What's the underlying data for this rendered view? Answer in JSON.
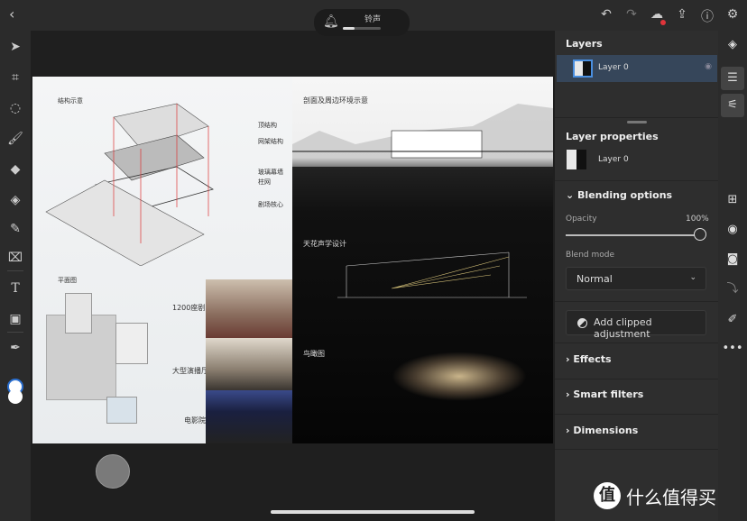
{
  "topbar": {
    "back_icon": "chevron-left-icon",
    "ringer_label": "铃声",
    "ringer_level_percent": 30,
    "icons": [
      "undo-icon",
      "redo-icon",
      "cloud-sync-error-icon",
      "share-icon",
      "help-icon",
      "settings-icon"
    ],
    "cloud_badge_color": "#e0343a"
  },
  "left_tools": [
    "select-icon",
    "transform-icon",
    "lasso-icon",
    "brush-icon",
    "eraser-icon",
    "fill-icon",
    "healing-icon",
    "crop-icon",
    "type-icon",
    "place-image-icon",
    "eyedropper-icon",
    "color-swatch"
  ],
  "poster": {
    "structure_title": "结构示意",
    "structure_labels": [
      "顶结构",
      "网架结构",
      "玻璃幕墙",
      "柱网",
      "剧场核心"
    ],
    "section_title": "剖面及周边环境示意",
    "plan_title": "平面图",
    "photo_labels": [
      "1200座剧院",
      "大型演播厅",
      "电影院"
    ],
    "acoustic_title": "天花声学设计",
    "aerial_title": "鸟瞰图"
  },
  "layers_panel": {
    "title": "Layers",
    "layer_name": "Layer 0"
  },
  "properties": {
    "title": "Layer properties",
    "layer_name": "Layer 0",
    "blending_title": "Blending options",
    "opacity_label": "Opacity",
    "opacity_value": "100%",
    "opacity_percent": 100,
    "blend_mode_label": "Blend mode",
    "blend_mode_value": "Normal",
    "clipped_button": "Add clipped adjustment",
    "sections": [
      "Effects",
      "Smart filters",
      "Dimensions"
    ]
  },
  "right_strip": [
    "layers-icon",
    "layer-properties-icon",
    "adjustments-icon",
    "add-layer-icon",
    "visibility-icon",
    "mask-icon",
    "clip-icon",
    "fx-icon",
    "more-icon"
  ],
  "watermark": {
    "logo": "值",
    "text": "什么值得买"
  }
}
